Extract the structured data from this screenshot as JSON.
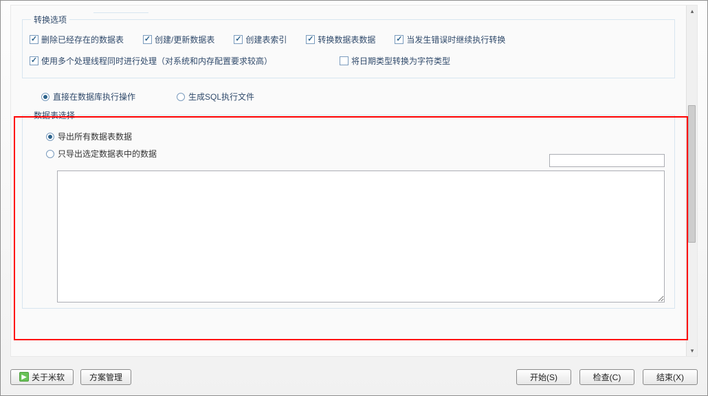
{
  "convert_options": {
    "legend": "转换选项",
    "row1": [
      {
        "label": "删除已经存在的数据表",
        "checked": true
      },
      {
        "label": "创建/更新数据表",
        "checked": true
      },
      {
        "label": "创建表索引",
        "checked": true
      },
      {
        "label": "转换数据表数据",
        "checked": true
      },
      {
        "label": "当发生错误时继续执行转换",
        "checked": true
      }
    ],
    "row2": [
      {
        "label": "使用多个处理线程同时进行处理（对系统和内存配置要求较高）",
        "checked": true
      },
      {
        "label": "将日期类型转换为字符类型",
        "checked": false
      }
    ]
  },
  "exec_mode": {
    "options": [
      {
        "label": "直接在数据库执行操作",
        "selected": true
      },
      {
        "label": "生成SQL执行文件",
        "selected": false
      }
    ]
  },
  "table_select": {
    "legend": "数据表选择",
    "options": [
      {
        "label": "导出所有数据表数据",
        "selected": true
      },
      {
        "label": "只导出选定数据表中的数据",
        "selected": false
      }
    ],
    "filter_value": "",
    "textarea_value": ""
  },
  "buttons": {
    "about": "关于米软",
    "plan_mgmt": "方案管理",
    "start": "开始(S)",
    "check": "检查(C)",
    "end": "结束(X)"
  }
}
